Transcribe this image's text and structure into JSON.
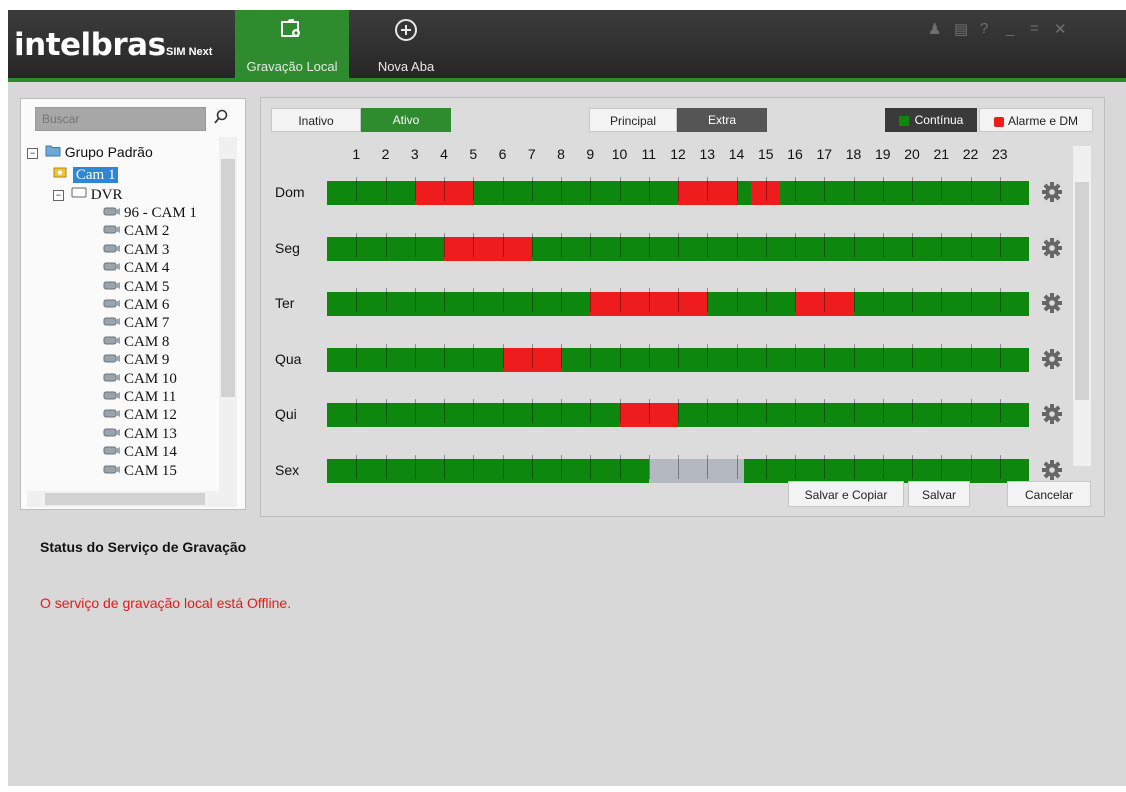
{
  "app": {
    "logo": "intelbras",
    "logo_sub": "SIM Next",
    "tabs": [
      {
        "label": "Gravação Local",
        "icon": "folder-settings-icon",
        "active": true
      },
      {
        "label": "Nova Aba",
        "icon": "add-circle-icon",
        "active": false
      }
    ],
    "window_controls": [
      "user-icon",
      "lock-icon",
      "help-icon",
      "minimize-icon",
      "maximize-icon",
      "close-icon"
    ]
  },
  "tree": {
    "search_placeholder": "Buscar",
    "group": "Grupo Padrão",
    "selected_camera": "Cam 1",
    "dvr": "DVR",
    "cameras": [
      "96 - CAM 1",
      "CAM 2",
      "CAM 3",
      "CAM 4",
      "CAM 5",
      "CAM 6",
      "CAM 7",
      "CAM 8",
      "CAM 9",
      "CAM 10",
      "CAM 11",
      "CAM 12",
      "CAM 13",
      "CAM 14",
      "CAM 15"
    ]
  },
  "schedule": {
    "state_toggle": {
      "inactive": "Inativo",
      "active": "Ativo",
      "selected": "Ativo"
    },
    "stream_toggle": {
      "main": "Principal",
      "extra": "Extra",
      "selected": "Extra"
    },
    "legend": {
      "continuous": "Contínua",
      "alarm": "Alarme e DM"
    },
    "colors": {
      "continuous": "#0d870d",
      "alarm": "#ee1c1c",
      "empty": "#b4b8c0",
      "active_tab": "#2e8b2e"
    },
    "hours": [
      1,
      2,
      3,
      4,
      5,
      6,
      7,
      8,
      9,
      10,
      11,
      12,
      13,
      14,
      15,
      16,
      17,
      18,
      19,
      20,
      21,
      22,
      23
    ],
    "days": [
      {
        "label": "Dom",
        "segments": [
          {
            "start": 3,
            "end": 5,
            "type": "alarm"
          },
          {
            "start": 12,
            "end": 14,
            "type": "alarm"
          },
          {
            "start": 14.5,
            "end": 15.5,
            "type": "alarm"
          }
        ]
      },
      {
        "label": "Seg",
        "segments": [
          {
            "start": 4,
            "end": 7,
            "type": "alarm"
          }
        ]
      },
      {
        "label": "Ter",
        "segments": [
          {
            "start": 9,
            "end": 13,
            "type": "alarm"
          },
          {
            "start": 16,
            "end": 18,
            "type": "alarm"
          }
        ]
      },
      {
        "label": "Qua",
        "segments": [
          {
            "start": 6,
            "end": 8,
            "type": "alarm"
          }
        ]
      },
      {
        "label": "Qui",
        "segments": [
          {
            "start": 10,
            "end": 12,
            "type": "alarm"
          }
        ]
      },
      {
        "label": "Sex",
        "segments": [
          {
            "start": 11,
            "end": 14.25,
            "type": "empty"
          }
        ]
      }
    ],
    "buttons": {
      "save_copy": "Salvar e Copiar",
      "save": "Salvar",
      "cancel": "Cancelar"
    }
  },
  "status": {
    "title": "Status do Serviço de Gravação",
    "message": "O serviço de gravação local está Offline."
  }
}
